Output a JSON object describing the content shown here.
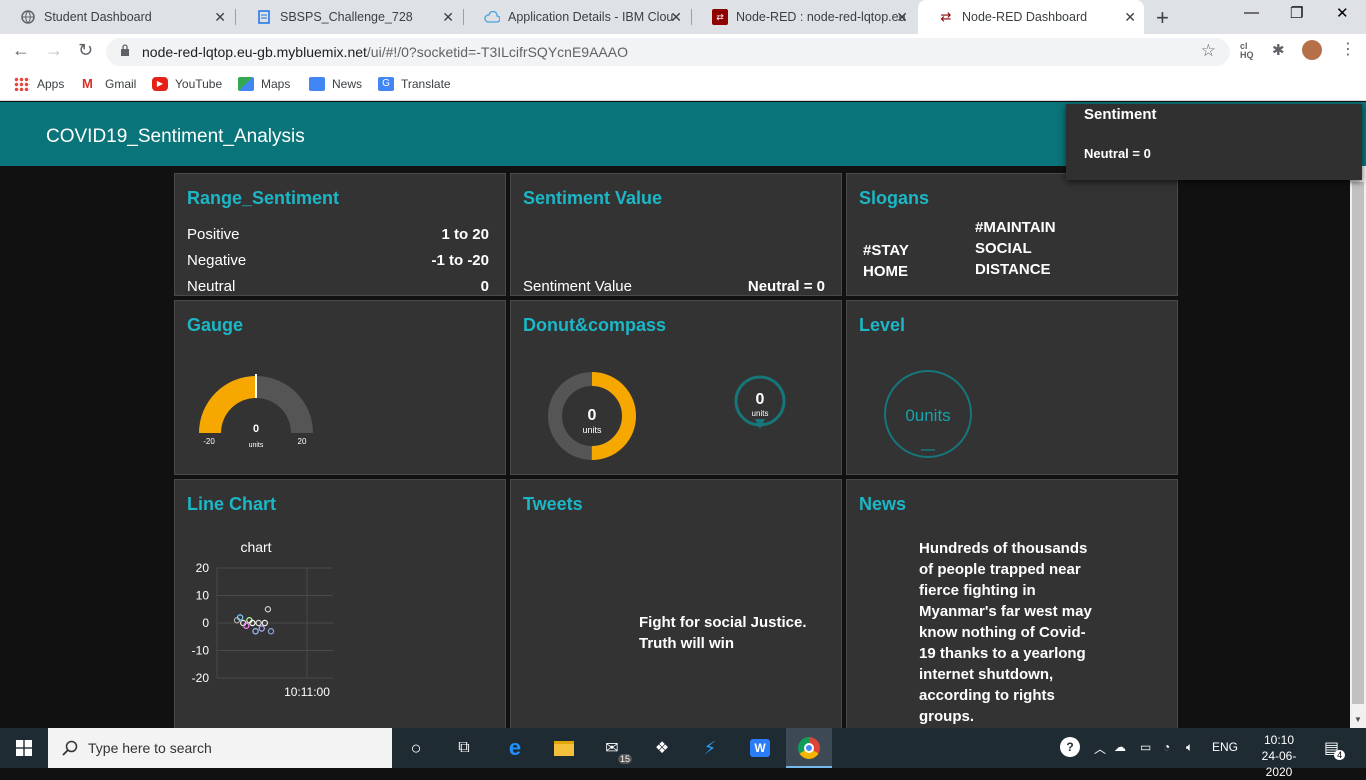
{
  "browser": {
    "tabs": [
      {
        "title": "Student Dashboard"
      },
      {
        "title": "SBSPS_Challenge_728"
      },
      {
        "title": "Application Details - IBM Clou"
      },
      {
        "title": "Node-RED : node-red-lqtop.eu"
      },
      {
        "title": "Node-RED Dashboard"
      }
    ],
    "url_host": "node-red-lqtop.eu-gb.mybluemix.net",
    "url_path": "/ui/#!/0?socketid=-T3ILcifrSQYcnE9AAAO",
    "bookmarks": [
      "Apps",
      "Gmail",
      "YouTube",
      "Maps",
      "News",
      "Translate"
    ]
  },
  "dashboard": {
    "title": "COVID19_Sentiment_Analysis",
    "toast": {
      "title": "Sentiment",
      "message": "Neutral = 0"
    },
    "range_sentiment": {
      "title": "Range_Sentiment",
      "rows": [
        {
          "label": "Positive",
          "value": "1 to 20"
        },
        {
          "label": "Negative",
          "value": "-1 to -20"
        },
        {
          "label": "Neutral",
          "value": "0"
        }
      ]
    },
    "sentiment_value": {
      "title": "Sentiment Value",
      "label": "Sentiment Value",
      "value": "Neutral = 0"
    },
    "slogans": {
      "title": "Slogans",
      "left": [
        "#STAY",
        "HOME"
      ],
      "right": [
        "#MAINTAIN",
        "SOCIAL",
        "DISTANCE"
      ]
    },
    "gauge": {
      "title": "Gauge",
      "value": "0",
      "units": "units",
      "min": "-20",
      "max": "20",
      "fraction": 0.5
    },
    "donut": {
      "title": "Donut&compass",
      "donut_value": "0",
      "donut_units": "units",
      "compass_value": "0",
      "compass_units": "units",
      "donut_fraction": 0.5
    },
    "level": {
      "title": "Level",
      "text": "0units"
    },
    "line_chart": {
      "title": "Line Chart"
    },
    "tweets": {
      "title": "Tweets",
      "text": [
        "Fight for social Justice.",
        "Truth will win"
      ]
    },
    "news": {
      "title": "News",
      "lines": [
        "Hundreds of thousands",
        "of people trapped near",
        "fierce fighting in",
        "Myanmar's far west may",
        "know nothing of Covid-",
        "19 thanks to a yearlong",
        "internet shutdown,",
        "according to rights",
        "groups."
      ]
    }
  },
  "chart_data": {
    "type": "scatter",
    "title": "chart",
    "xlabel": "",
    "ylabel": "",
    "yticks": [
      "20",
      "10",
      "0",
      "-10",
      "-20"
    ],
    "xticks": [
      "10:11:00"
    ],
    "ylim": [
      -20,
      20
    ],
    "series": [
      {
        "x": [
          1,
          2,
          3,
          4,
          5,
          6,
          7,
          8,
          9,
          10,
          11,
          12
        ],
        "values": [
          1,
          2,
          0,
          -1,
          1,
          0,
          -3,
          0,
          -2,
          0,
          5,
          -3
        ],
        "color": "#aaaaaa"
      }
    ]
  },
  "taskbar": {
    "search_placeholder": "Type here to search",
    "time": "10:10",
    "date": "24-06-2020",
    "lang": "ENG",
    "mail_count": "15",
    "notif_count": "4"
  }
}
